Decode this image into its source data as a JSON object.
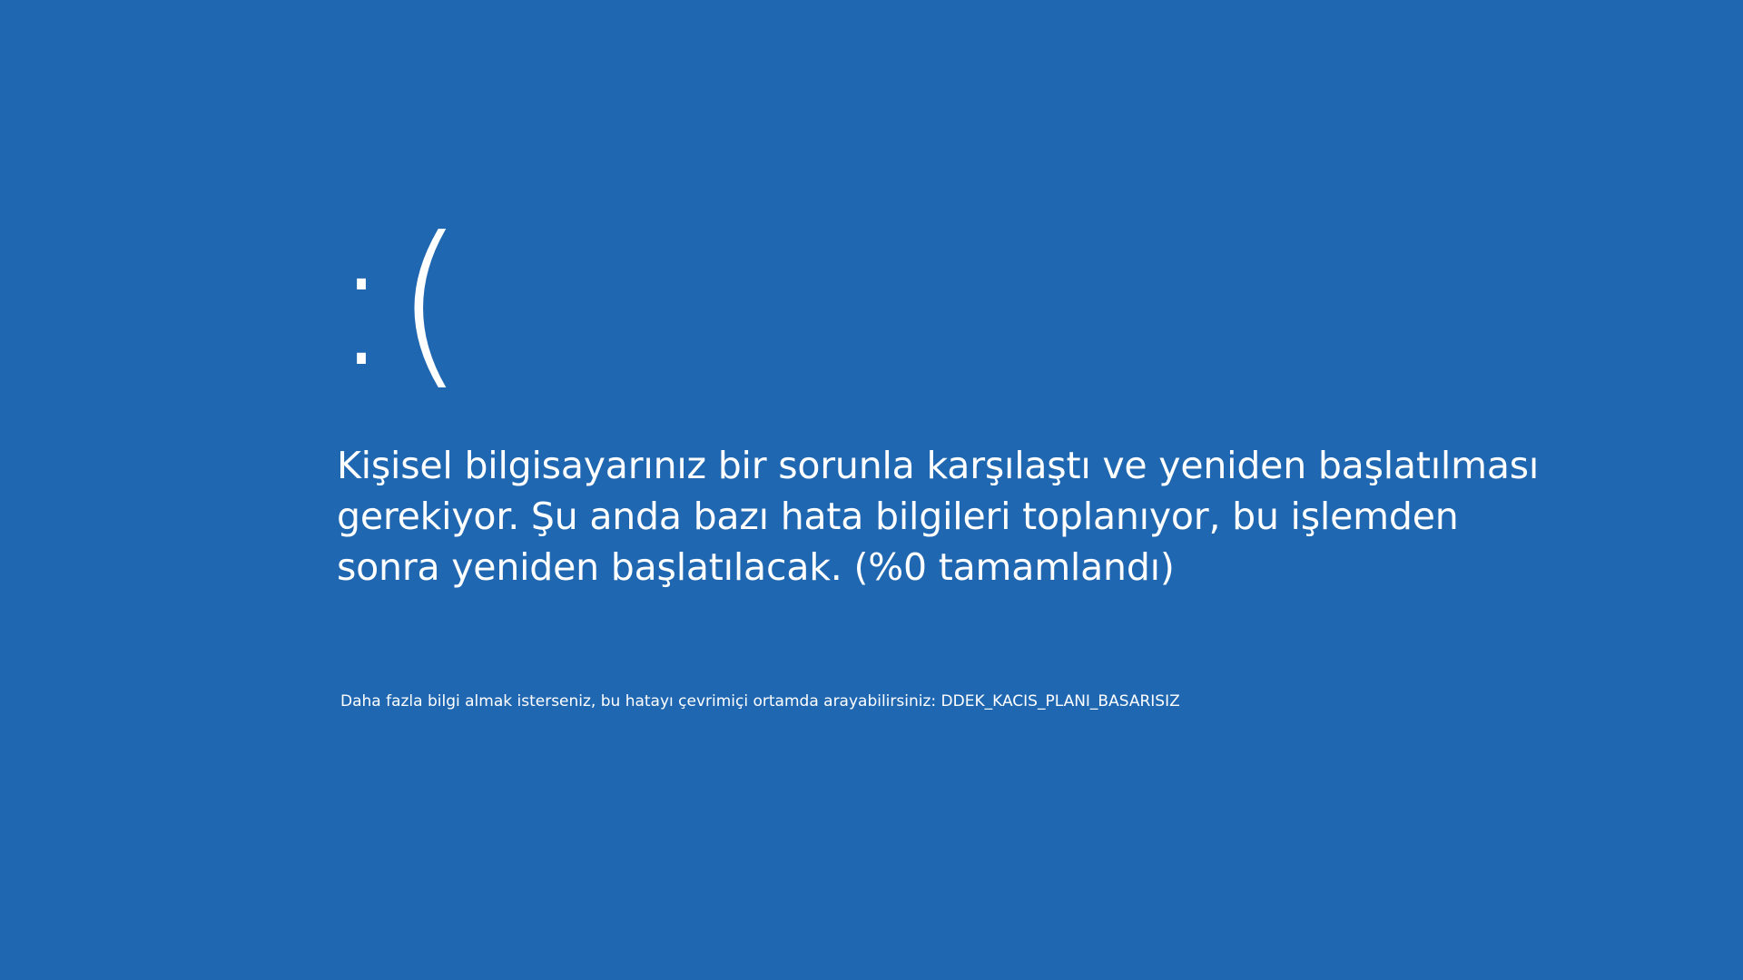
{
  "screen": {
    "background_color": "#2067b2",
    "text_color": "#ffffff",
    "face": ":(",
    "message_lines": [
      "Kişisel bilgisayarınız bir sorunla karşılaştı ve yeniden başlatılması",
      "gerekiyor. Şu anda bazı hata bilgileri toplanıyor, bu işlemden",
      "sonra yeniden başlatılacak. (%0 tamamlandı)"
    ],
    "progress_percent": 0,
    "info_text": "Daha fazla bilgi almak isterseniz, bu hatayı çevrimiçi ortamda arayabilirsiniz: DDEK_KACIS_PLANI_BASARISIZ"
  }
}
